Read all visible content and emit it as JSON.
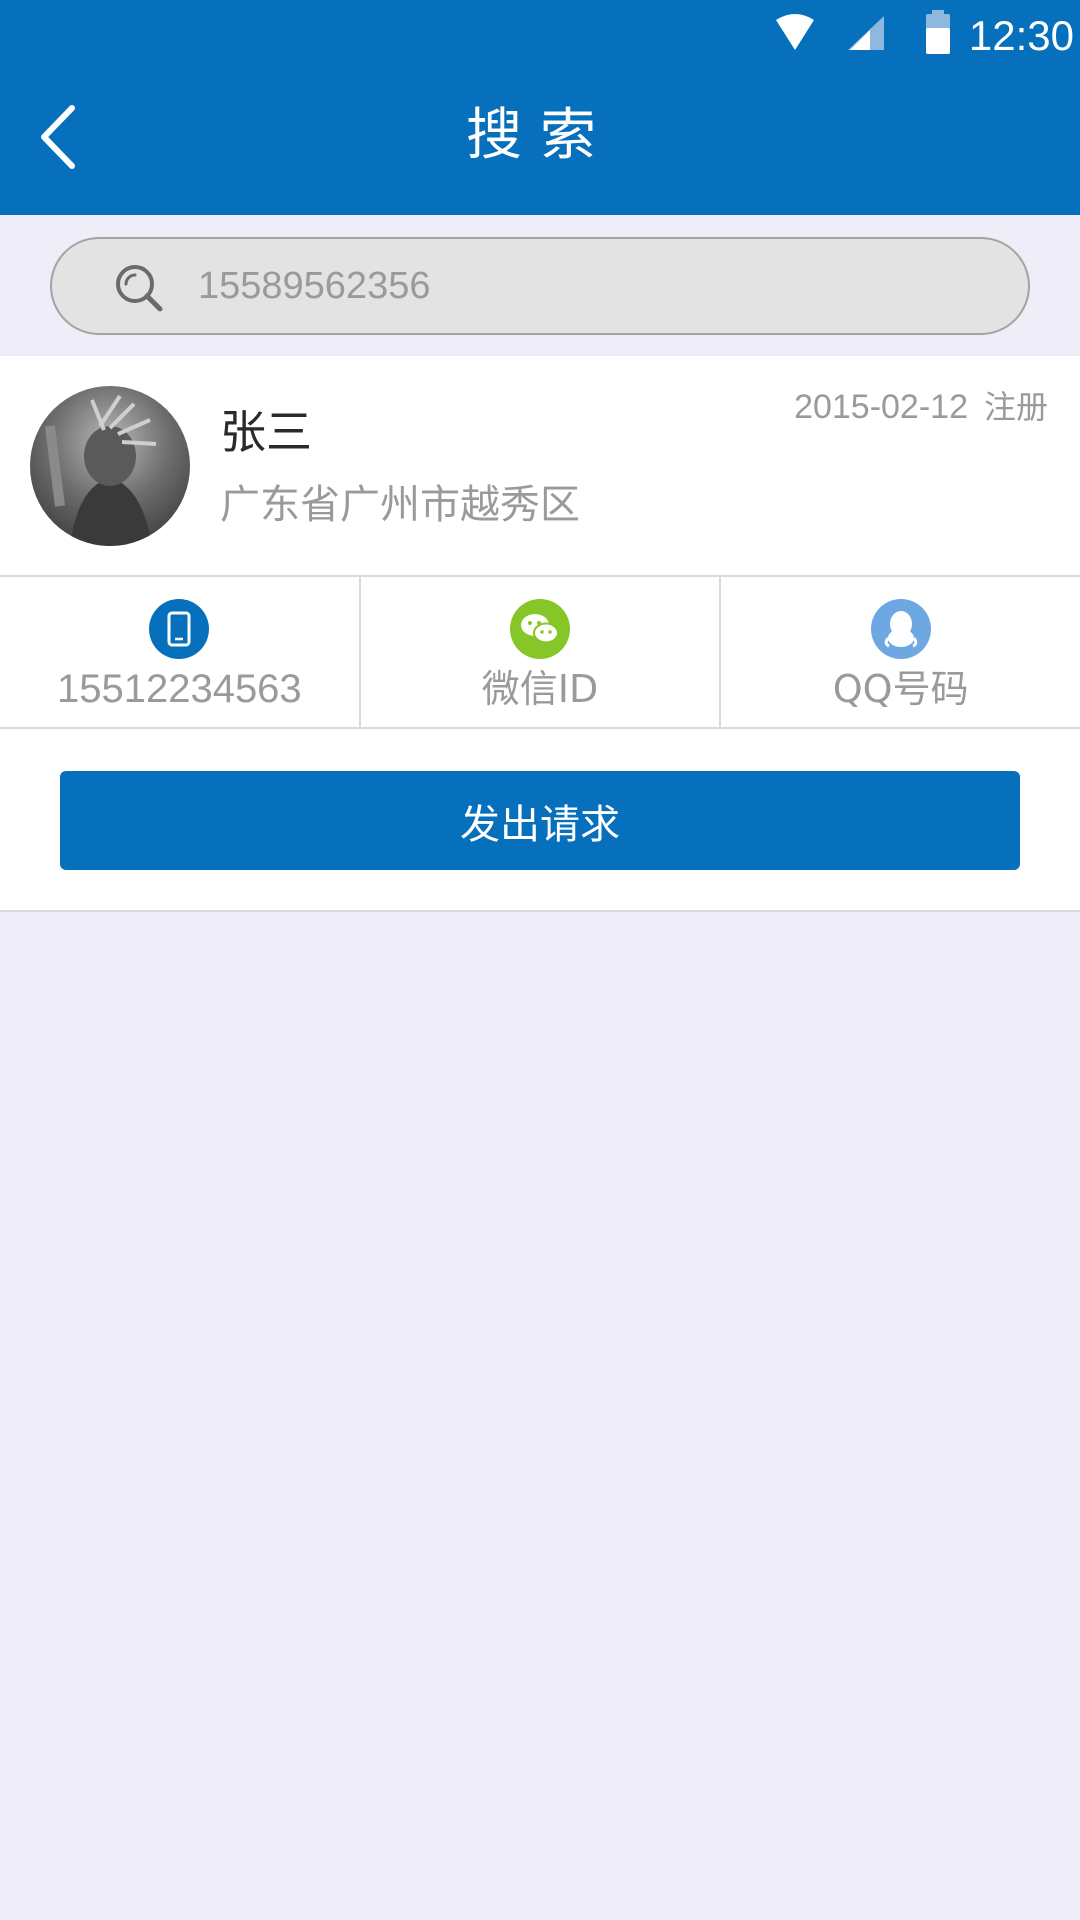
{
  "status_bar": {
    "time": "12:30",
    "icons": [
      "wifi-icon",
      "signal-icon",
      "battery-icon"
    ]
  },
  "header": {
    "title": "搜索",
    "back_icon": "chevron-left-icon"
  },
  "search": {
    "value": "15589562356",
    "icon": "search-icon"
  },
  "result": {
    "name": "张三",
    "location": "广东省广州市越秀区",
    "register_date": "2015-02-12",
    "register_label": "注册",
    "contacts": [
      {
        "label": "15512234563",
        "icon": "phone-icon",
        "color": "#0670bd"
      },
      {
        "label": "微信ID",
        "icon": "wechat-icon",
        "color": "#86c626"
      },
      {
        "label": "QQ号码",
        "icon": "qq-icon",
        "color": "#6ea8e3"
      }
    ]
  },
  "actions": {
    "request_label": "发出请求"
  },
  "colors": {
    "primary": "#0670bd",
    "background": "#efeef8",
    "muted_text": "#9a9a9a"
  }
}
